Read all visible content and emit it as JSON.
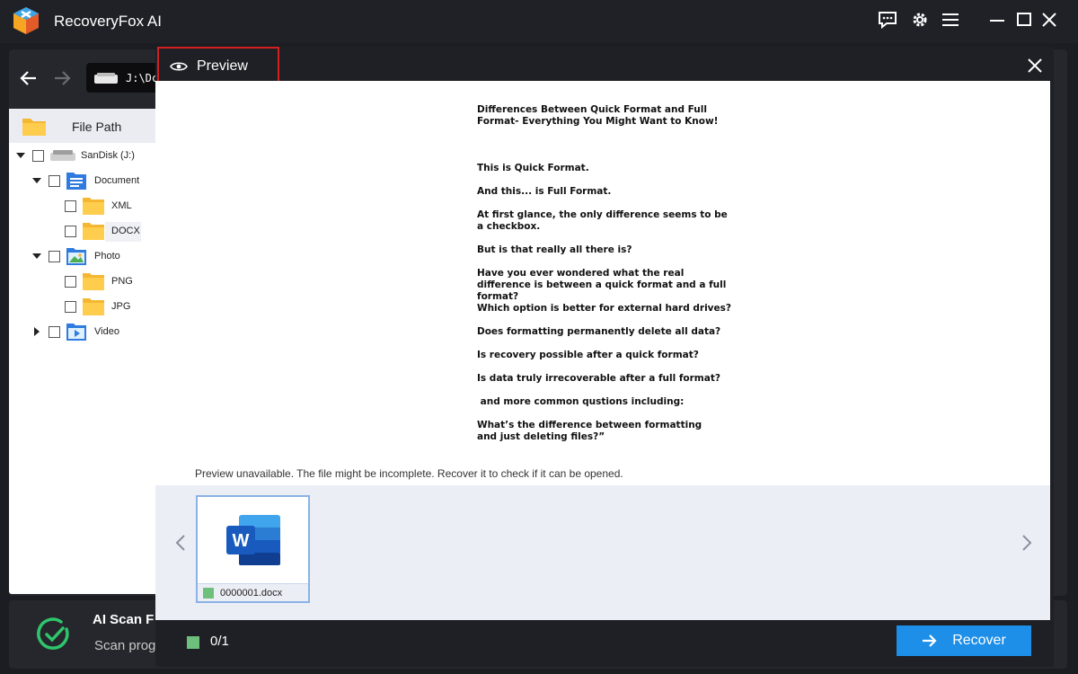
{
  "app": {
    "title": "RecoveryFox AI"
  },
  "nav": {
    "path": "J:\\Dc"
  },
  "left_panel": {
    "header": "File Path",
    "tree": [
      {
        "label": "SanDisk (J:)",
        "type": "drive"
      },
      {
        "label": "Document",
        "type": "folder-doc"
      },
      {
        "label": "XML",
        "type": "folder"
      },
      {
        "label": "DOCX",
        "type": "folder",
        "selected": true
      },
      {
        "label": "Photo",
        "type": "folder-photo"
      },
      {
        "label": "PNG",
        "type": "folder"
      },
      {
        "label": "JPG",
        "type": "folder"
      },
      {
        "label": "Video",
        "type": "folder-video"
      }
    ]
  },
  "status": {
    "title": "AI Scan F",
    "subtitle": "Scan prog"
  },
  "modal": {
    "tab_label": "Preview",
    "document_lines": [
      "Differences Between Quick Format and Full Format- Everything You Might Want to Know!",
      "This is Quick Format.",
      "And this... is Full Format.",
      "At first glance, the only difference seems to be a checkbox.",
      "But is that really all there is?",
      "Have you ever wondered what the real difference is between a quick format and a full format?",
      "Which option is better for external hard drives?",
      "Does formatting permanently delete all data?",
      "Is recovery possible after a quick format?",
      "Is data truly irrecoverable after a full format?",
      " and more common qustions including:",
      "What’s the difference between formatting and just deleting files?”"
    ],
    "unavailable_msg": "Preview unavailable. The file might be incomplete. Recover it to check if it can be opened.",
    "thumbnail": {
      "filename": "0000001.docx",
      "icon": "word-icon"
    },
    "selection_count": "0/1",
    "recover_label": "Recover"
  },
  "colors": {
    "accent": "#1d8fe8",
    "highlight_border": "#d31f1f",
    "status_green": "#6ebf7c"
  }
}
